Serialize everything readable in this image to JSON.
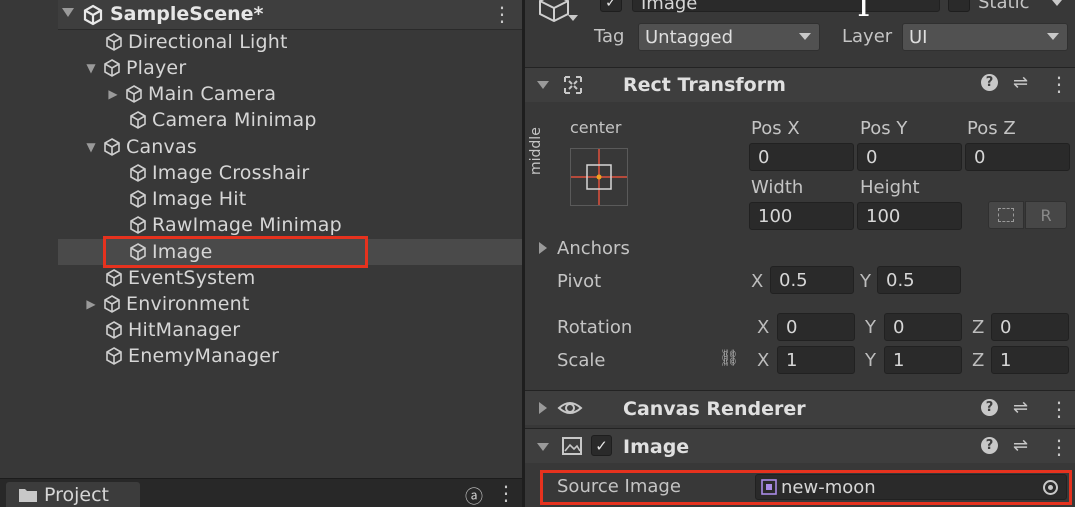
{
  "hierarchy": {
    "scene_name": "SampleScene*",
    "items": [
      {
        "label": "Directional Light"
      },
      {
        "label": "Player"
      },
      {
        "label": "Main Camera"
      },
      {
        "label": "Camera Minimap"
      },
      {
        "label": "Canvas"
      },
      {
        "label": "Image Crosshair"
      },
      {
        "label": "Image Hit"
      },
      {
        "label": "RawImage Minimap"
      },
      {
        "label": "Image"
      },
      {
        "label": "EventSystem"
      },
      {
        "label": "Environment"
      },
      {
        "label": "HitManager"
      },
      {
        "label": "EnemyManager"
      }
    ]
  },
  "project_tab": {
    "label": "Project"
  },
  "inspector": {
    "object_name": "Image",
    "static_label": "Static",
    "tag_label": "Tag",
    "tag_value": "Untagged",
    "layer_label": "Layer",
    "layer_value": "UI"
  },
  "rect_transform": {
    "title": "Rect Transform",
    "anchor_h": "center",
    "anchor_v": "middle",
    "pos_x_label": "Pos X",
    "pos_y_label": "Pos Y",
    "pos_z_label": "Pos Z",
    "pos_x": "0",
    "pos_y": "0",
    "pos_z": "0",
    "width_label": "Width",
    "height_label": "Height",
    "width": "100",
    "height": "100",
    "r_button": "R",
    "anchors_label": "Anchors",
    "pivot_label": "Pivot",
    "pivot_x_axis": "X",
    "pivot_x": "0.5",
    "pivot_y_axis": "Y",
    "pivot_y": "0.5",
    "rotation_label": "Rotation",
    "rot_x_axis": "X",
    "rot_x": "0",
    "rot_y_axis": "Y",
    "rot_y": "0",
    "rot_z_axis": "Z",
    "rot_z": "0",
    "scale_label": "Scale",
    "scale_x_axis": "X",
    "scale_x": "1",
    "scale_y_axis": "Y",
    "scale_y": "1",
    "scale_z_axis": "Z",
    "scale_z": "1"
  },
  "canvas_renderer": {
    "title": "Canvas Renderer"
  },
  "image_component": {
    "title": "Image",
    "source_image_label": "Source Image",
    "source_image_value": "new-moon"
  },
  "colors": {
    "highlight": "#e6321e",
    "accent_orange": "#f0a020"
  }
}
